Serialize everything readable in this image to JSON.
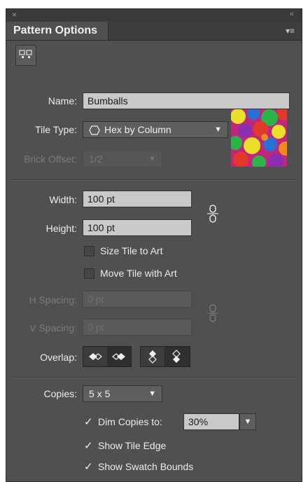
{
  "window": {
    "close_glyph": "×",
    "collapse_glyph": "‹‹"
  },
  "panel": {
    "title": "Pattern Options",
    "menu_glyph": "▾≡"
  },
  "name": {
    "label": "Name:",
    "value": "Bumballs"
  },
  "tile_type": {
    "label": "Tile Type:",
    "value": "Hex by Column",
    "icon": "hexagon-icon"
  },
  "brick_offset": {
    "label": "Brick Offset:",
    "value": "1/2",
    "disabled": true
  },
  "width": {
    "label": "Width:",
    "value": "100 pt"
  },
  "height": {
    "label": "Height:",
    "value": "100 pt"
  },
  "size_tile_to_art": {
    "label": "Size Tile to Art",
    "checked": false
  },
  "move_tile_with_art": {
    "label": "Move Tile with Art",
    "checked": false
  },
  "h_spacing": {
    "label": "H Spacing:",
    "value": "0 pt",
    "disabled": true
  },
  "v_spacing": {
    "label": "V Spacing:",
    "value": "0 pt",
    "disabled": true
  },
  "overlap": {
    "label": "Overlap:"
  },
  "copies": {
    "label": "Copies:",
    "value": "5 x 5"
  },
  "dim_copies": {
    "label": "Dim Copies to:",
    "checked": true,
    "value": "30%"
  },
  "show_tile_edge": {
    "label": "Show Tile Edge",
    "checked": true
  },
  "show_swatch_bounds": {
    "label": "Show Swatch Bounds",
    "checked": true
  },
  "colors": {
    "panel_bg": "#505050",
    "field_bg": "#c9c9c9",
    "swatch": [
      "#c0267a",
      "#e8e02a",
      "#2bb44a",
      "#2a6fd6",
      "#e23a2a",
      "#8a2fb0",
      "#f08a1c"
    ]
  }
}
